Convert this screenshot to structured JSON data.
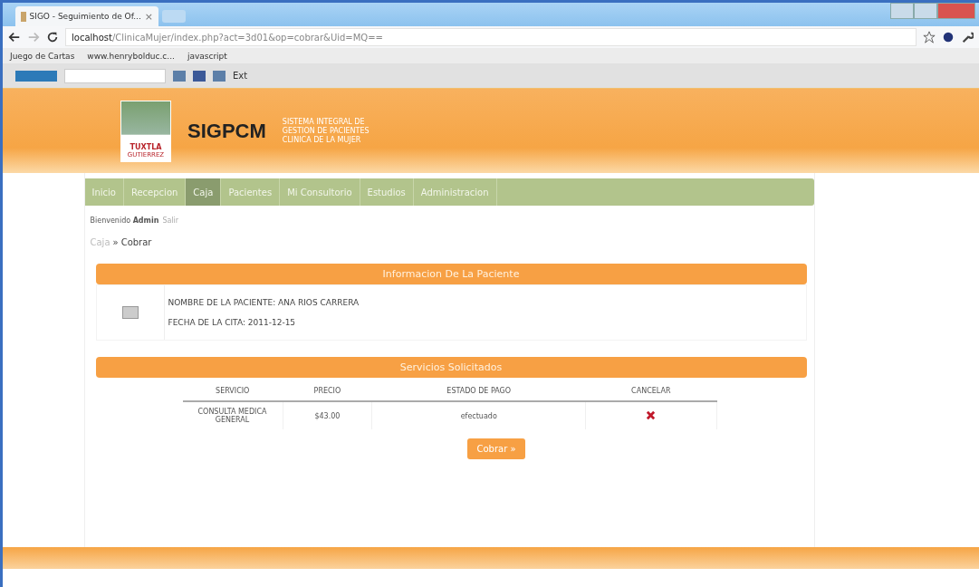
{
  "browser": {
    "tab_title": "SIGO - Seguimiento de Of...",
    "close_tab": "×",
    "url_host": "localhost",
    "url_path": "/ClinicaMujer/index.php?act=3d01&op=cobrar&Uid=MQ==",
    "bookmarks": [
      "Juego de Cartas",
      "www.henrybolduc.c...",
      "javascript"
    ],
    "toolbar_text": "Ext"
  },
  "header": {
    "logo_city": "TUXTLA",
    "logo_sub": "GUTIERREZ",
    "brand": "SIGPCM",
    "brand_lines": [
      "SISTEMA INTEGRAL DE",
      "GESTION DE PACIENTES",
      "CLINICA DE LA MUJER"
    ]
  },
  "nav": [
    {
      "label": "Inicio",
      "selected": false
    },
    {
      "label": "Recepcion",
      "selected": false
    },
    {
      "label": "Caja",
      "selected": true
    },
    {
      "label": "Pacientes",
      "selected": false
    },
    {
      "label": "Mi Consultorio",
      "selected": false
    },
    {
      "label": "Estudios",
      "selected": false
    },
    {
      "label": "Administracion",
      "selected": false
    }
  ],
  "welcome": {
    "text": "Bienvenido",
    "user": "Admin",
    "logout": "Salir"
  },
  "breadcrumb": {
    "parent": "Caja",
    "separator": "»",
    "current": "Cobrar"
  },
  "patient": {
    "heading": "Informacion De La Paciente",
    "name": "NOMBRE DE LA PACIENTE: ANA RIOS CARRERA",
    "date": "FECHA DE LA CITA: 2011-12-15"
  },
  "services": {
    "heading": "Servicios Solicitados",
    "columns": [
      "SERVICIO",
      "PRECIO",
      "ESTADO DE PAGO",
      "CANCELAR"
    ],
    "rows": [
      {
        "service": "CONSULTA MEDICA GENERAL",
        "price": "$43.00",
        "status": "efectuado"
      }
    ]
  },
  "action": {
    "label": "Cobrar »"
  }
}
